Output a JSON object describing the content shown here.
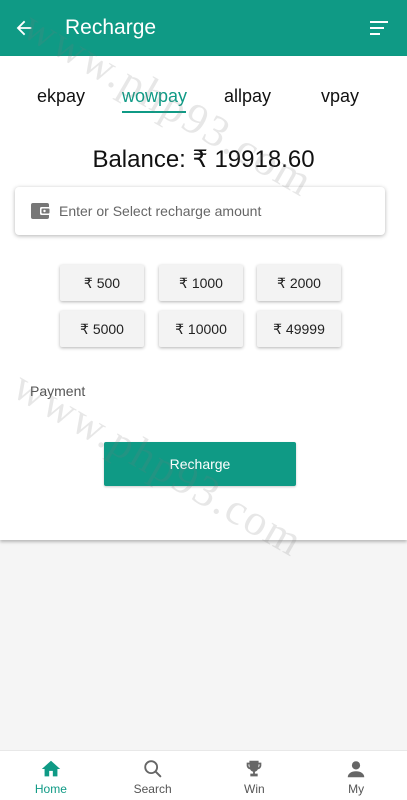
{
  "header": {
    "title": "Recharge",
    "back_icon": "arrow-left-icon",
    "menu_icon": "menu-lines-icon",
    "color": "#0f9a85"
  },
  "tabs": [
    {
      "label": "ekpay",
      "active": false
    },
    {
      "label": "wowpay",
      "active": true
    },
    {
      "label": "allpay",
      "active": false
    },
    {
      "label": "vpay",
      "active": false
    }
  ],
  "balance": {
    "text": "Balance: ₹ 19918.60"
  },
  "amount_field": {
    "placeholder": "Enter or Select recharge amount",
    "icon": "wallet-icon"
  },
  "amount_options": [
    "₹ 500",
    "₹ 1000",
    "₹ 2000",
    "₹ 5000",
    "₹ 10000",
    "₹ 49999"
  ],
  "payment": {
    "label": "Payment"
  },
  "recharge_button": {
    "label": "Recharge"
  },
  "watermark": {
    "text": "www.php93.com"
  },
  "bottom_nav": [
    {
      "label": "Home",
      "icon": "home-icon",
      "active": true
    },
    {
      "label": "Search",
      "icon": "search-icon",
      "active": false
    },
    {
      "label": "Win",
      "icon": "trophy-icon",
      "active": false
    },
    {
      "label": "My",
      "icon": "user-icon",
      "active": false
    }
  ]
}
